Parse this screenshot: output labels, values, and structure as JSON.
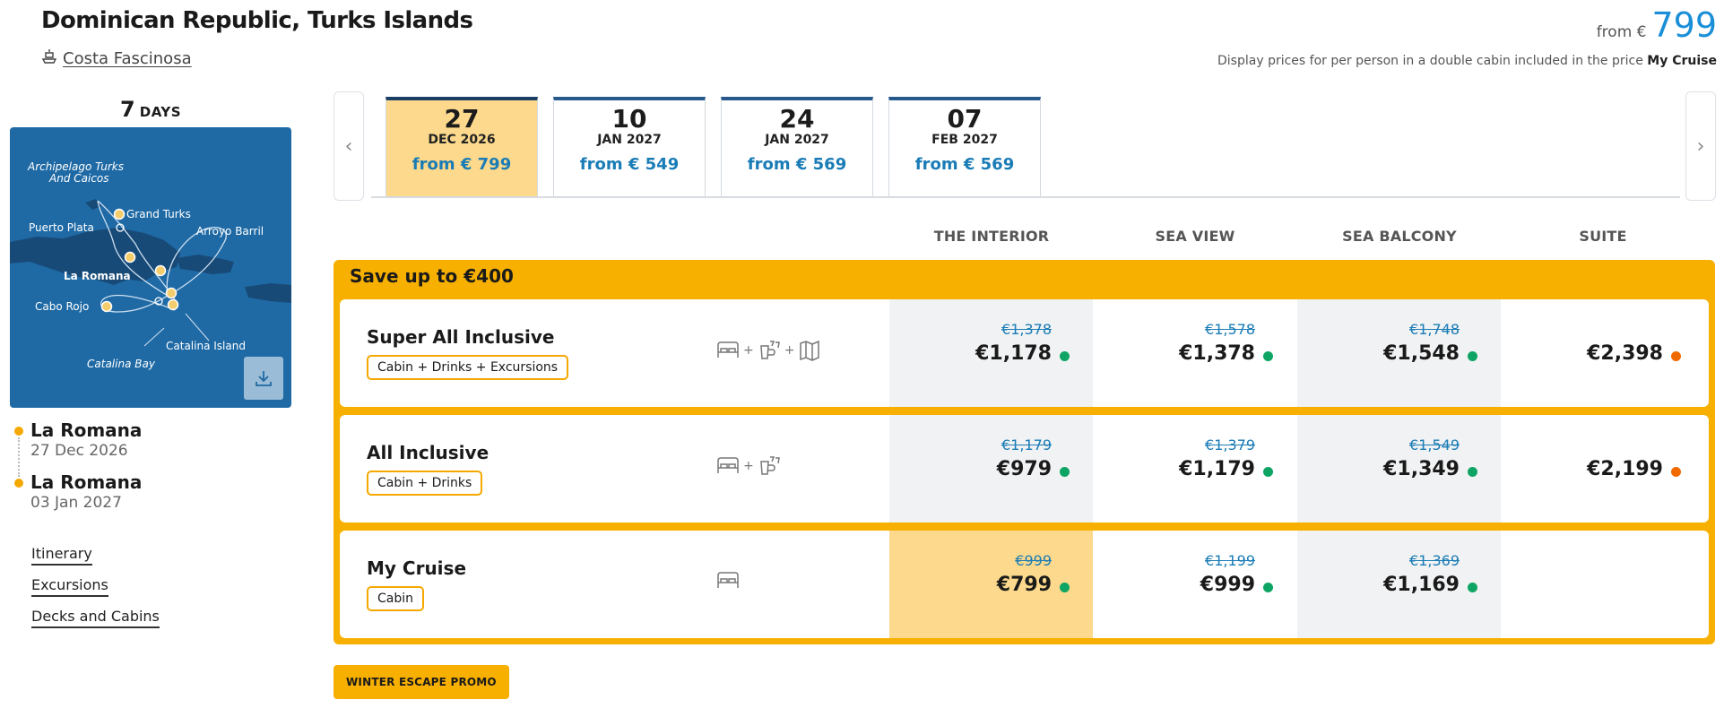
{
  "header": {
    "title": "Dominican Republic, Turks Islands",
    "ship": "Costa Fascinosa",
    "price_prefix": "from €",
    "price_value": "799",
    "display_note_prefix": "Display prices for per person in a double cabin included in the price ",
    "display_note_bold": "My Cruise"
  },
  "duration": {
    "number": "7",
    "unit": "DAYS"
  },
  "map": {
    "labels": {
      "turks_1": "Archipelago Turks",
      "turks_2": "And Caicos",
      "grand_turks": "Grand Turks",
      "puerto_plata": "Puerto Plata",
      "arroyo_barril": "Arroyo Barril",
      "la_romana": "La Romana",
      "cabo_rojo": "Cabo Rojo",
      "catalina_island": "Catalina Island",
      "catalina_bay": "Catalina Bay"
    },
    "download_icon": "download-icon"
  },
  "stops": [
    {
      "port": "La Romana",
      "date": "27 Dec 2026"
    },
    {
      "port": "La Romana",
      "date": "03 Jan 2027"
    }
  ],
  "side_links": [
    "Itinerary",
    "Excursions",
    "Decks and Cabins"
  ],
  "date_tabs": [
    {
      "day": "27",
      "month": "DEC 2026",
      "price": "from € 799",
      "active": true
    },
    {
      "day": "10",
      "month": "JAN 2027",
      "price": "from € 549",
      "active": false
    },
    {
      "day": "24",
      "month": "JAN 2027",
      "price": "from € 569",
      "active": false
    },
    {
      "day": "07",
      "month": "FEB 2027",
      "price": "from € 569",
      "active": false
    }
  ],
  "arrows": {
    "prev": "‹",
    "next": "›"
  },
  "columns": [
    "THE INTERIOR",
    "SEA VIEW",
    "SEA BALCONY",
    "SUITE"
  ],
  "offer_banner": "Save up to €400",
  "packages": [
    {
      "name": "Super All Inclusive",
      "badge": "Cabin + Drinks + Excursions",
      "prices": [
        {
          "old": "€1,378",
          "new": "€1,178",
          "status": "green"
        },
        {
          "old": "€1,578",
          "new": "€1,378",
          "status": "green"
        },
        {
          "old": "€1,748",
          "new": "€1,548",
          "status": "green"
        },
        {
          "old": "",
          "new": "€2,398",
          "status": "orange"
        }
      ]
    },
    {
      "name": "All Inclusive",
      "badge": "Cabin + Drinks",
      "prices": [
        {
          "old": "€1,179",
          "new": "€979",
          "status": "green"
        },
        {
          "old": "€1,379",
          "new": "€1,179",
          "status": "green"
        },
        {
          "old": "€1,549",
          "new": "€1,349",
          "status": "green"
        },
        {
          "old": "",
          "new": "€2,199",
          "status": "orange"
        }
      ]
    },
    {
      "name": "My Cruise",
      "badge": "Cabin",
      "prices": [
        {
          "old": "€999",
          "new": "€799",
          "status": "green"
        },
        {
          "old": "€1,199",
          "new": "€999",
          "status": "green"
        },
        {
          "old": "€1,369",
          "new": "€1,169",
          "status": "green"
        },
        {
          "old": "",
          "new": "",
          "status": ""
        }
      ]
    }
  ],
  "plus_sign": "+",
  "promo_label": "WINTER ESCAPE PROMO",
  "colors": {
    "accent": "#f7b000",
    "selected": "#fcd98c",
    "link_blue": "#1a7cb6",
    "map_sea": "#1f6aa5"
  }
}
